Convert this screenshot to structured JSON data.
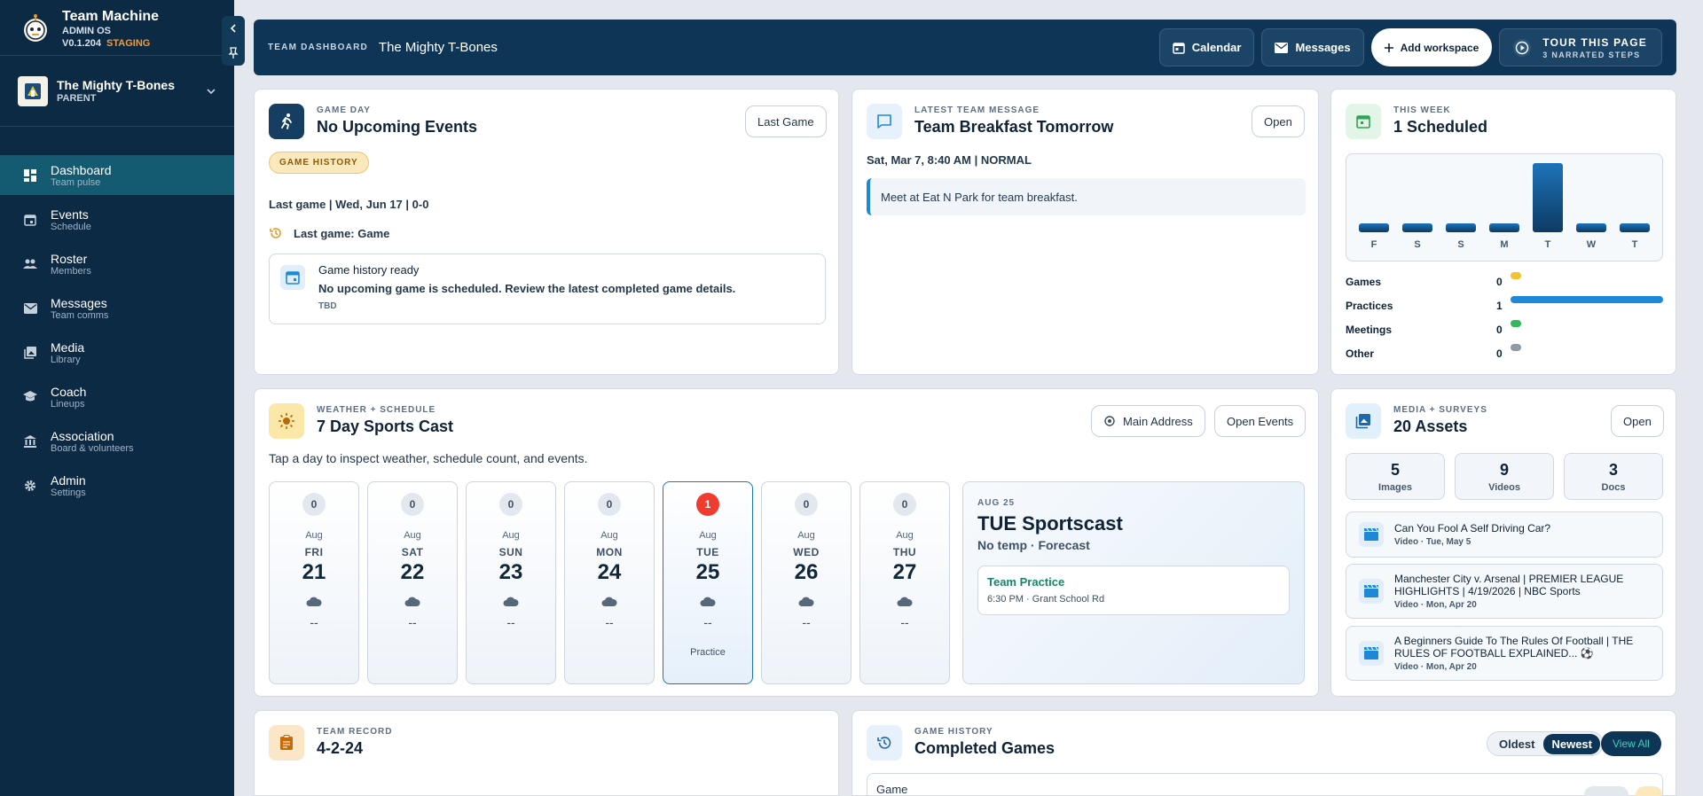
{
  "app": {
    "name": "Team Machine",
    "sub": "ADMIN OS",
    "version": "V0.1.204",
    "env": "STAGING"
  },
  "team": {
    "name": "The Mighty T-Bones",
    "role": "PARENT"
  },
  "nav": [
    {
      "label": "Dashboard",
      "sub": "Team pulse",
      "icon": "dashboard-icon"
    },
    {
      "label": "Events",
      "sub": "Schedule",
      "icon": "calendar-icon"
    },
    {
      "label": "Roster",
      "sub": "Members",
      "icon": "people-icon"
    },
    {
      "label": "Messages",
      "sub": "Team comms",
      "icon": "mail-icon"
    },
    {
      "label": "Media",
      "sub": "Library",
      "icon": "photo-library-icon"
    },
    {
      "label": "Coach",
      "sub": "Lineups",
      "icon": "school-icon"
    },
    {
      "label": "Association",
      "sub": "Board & volunteers",
      "icon": "bank-icon"
    },
    {
      "label": "Admin",
      "sub": "Settings",
      "icon": "gear-icon"
    }
  ],
  "topbar": {
    "label": "TEAM DASHBOARD",
    "title": "The Mighty T-Bones",
    "calendar": "Calendar",
    "messages": "Messages",
    "add": "Add workspace",
    "tour": "TOUR THIS PAGE",
    "tour_sub": "3 NARRATED STEPS"
  },
  "gameday": {
    "eyebrow": "GAME DAY",
    "title": "No Upcoming Events",
    "btn": "Last Game",
    "pill": "GAME HISTORY",
    "last": "Last game | Wed, Jun 17 | 0-0",
    "last2": "Last game: Game",
    "box_title": "Game history ready",
    "box_text": "No upcoming game is scheduled. Review the latest completed game details.",
    "box_sub": "TBD"
  },
  "message": {
    "eyebrow": "LATEST TEAM MESSAGE",
    "title": "Team Breakfast Tomorrow",
    "btn": "Open",
    "meta": "Sat, Mar 7, 8:40 AM | NORMAL",
    "body": "Meet at Eat N Park for team breakfast."
  },
  "week": {
    "eyebrow": "THIS WEEK",
    "title": "1 Scheduled",
    "days": [
      "F",
      "S",
      "S",
      "M",
      "T",
      "W",
      "T"
    ],
    "values": [
      0,
      0,
      0,
      0,
      1,
      0,
      0
    ],
    "legend": [
      {
        "label": "Games",
        "count": "0",
        "color": "#f2c230",
        "value": 0
      },
      {
        "label": "Practices",
        "count": "1",
        "color": "#1e88d8",
        "value": 1
      },
      {
        "label": "Meetings",
        "count": "0",
        "color": "#34b85b",
        "value": 0
      },
      {
        "label": "Other",
        "count": "0",
        "color": "#8f9aa6",
        "value": 0
      }
    ]
  },
  "weather": {
    "eyebrow": "WEATHER + SCHEDULE",
    "title": "7 Day Sports Cast",
    "btn_addr": "Main Address",
    "btn_events": "Open Events",
    "hint": "Tap a day to inspect weather, schedule count, and events.",
    "days": [
      {
        "count": "0",
        "mon": "Aug",
        "dow": "FRI",
        "num": "21",
        "temp": "--",
        "note": ""
      },
      {
        "count": "0",
        "mon": "Aug",
        "dow": "SAT",
        "num": "22",
        "temp": "--",
        "note": ""
      },
      {
        "count": "0",
        "mon": "Aug",
        "dow": "SUN",
        "num": "23",
        "temp": "--",
        "note": ""
      },
      {
        "count": "0",
        "mon": "Aug",
        "dow": "MON",
        "num": "24",
        "temp": "--",
        "note": ""
      },
      {
        "count": "1",
        "mon": "Aug",
        "dow": "TUE",
        "num": "25",
        "temp": "--",
        "note": "Practice"
      },
      {
        "count": "0",
        "mon": "Aug",
        "dow": "WED",
        "num": "26",
        "temp": "--",
        "note": ""
      },
      {
        "count": "0",
        "mon": "Aug",
        "dow": "THU",
        "num": "27",
        "temp": "--",
        "note": ""
      }
    ],
    "detail": {
      "date": "AUG 25",
      "title": "TUE Sportscast",
      "sub": "No temp · Forecast",
      "event": "Team Practice",
      "event_meta": "6:30 PM · Grant School Rd"
    }
  },
  "mediacard": {
    "eyebrow": "MEDIA + SURVEYS",
    "title": "20 Assets",
    "btn": "Open",
    "stats": [
      {
        "v": "5",
        "k": "Images"
      },
      {
        "v": "9",
        "k": "Videos"
      },
      {
        "v": "3",
        "k": "Docs"
      }
    ],
    "items": [
      {
        "title": "Can You Fool A Self Driving Car?",
        "meta": "Video · Tue, May 5"
      },
      {
        "title": "Manchester City v. Arsenal | PREMIER LEAGUE HIGHLIGHTS | 4/19/2026 | NBC Sports",
        "meta": "Video · Mon, Apr 20"
      },
      {
        "title": "A Beginners Guide To The Rules Of Football | THE RULES OF FOOTBALL EXPLAINED... ⚽",
        "meta": "Video · Mon, Apr 20"
      }
    ]
  },
  "record": {
    "eyebrow": "TEAM RECORD",
    "title": "4-2-24"
  },
  "history": {
    "eyebrow": "GAME HISTORY",
    "title": "Completed Games",
    "oldest": "Oldest",
    "newest": "Newest",
    "viewall": "View All",
    "row": "Game"
  }
}
